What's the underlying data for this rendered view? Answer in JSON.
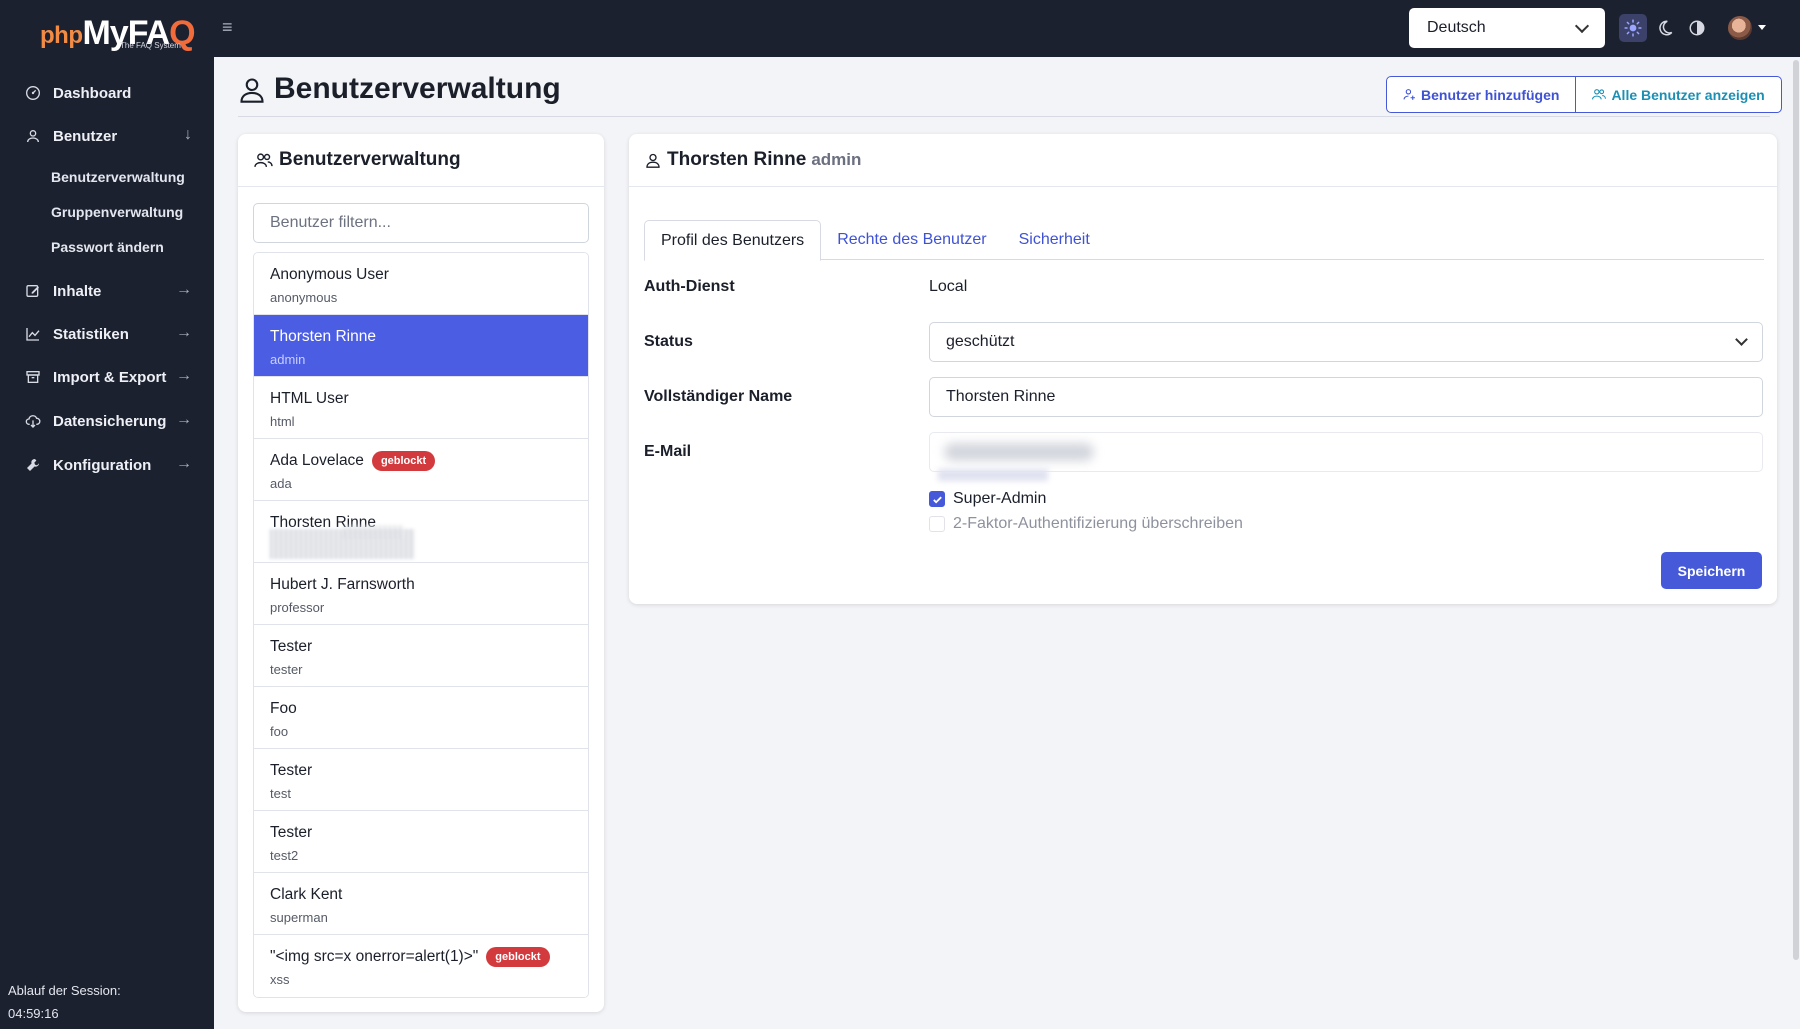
{
  "app": {
    "logo_php": "php",
    "logo_my": "MyFA",
    "logo_q": "Q",
    "logo_sub": "The FAQ System"
  },
  "topbar": {
    "language": "Deutsch"
  },
  "sidebar": {
    "items": [
      {
        "label": "Dashboard",
        "icon": "dashboard-icon"
      },
      {
        "label": "Benutzer",
        "icon": "user-icon",
        "arrow": "↓"
      },
      {
        "label": "Inhalte",
        "icon": "edit-icon",
        "arrow": "→"
      },
      {
        "label": "Statistiken",
        "icon": "chart-icon",
        "arrow": "→"
      },
      {
        "label": "Import & Export",
        "icon": "archive-icon",
        "arrow": "→"
      },
      {
        "label": "Datensicherung",
        "icon": "cloud-download-icon",
        "arrow": "→"
      },
      {
        "label": "Konfiguration",
        "icon": "wrench-icon",
        "arrow": "→"
      }
    ],
    "sub_items": [
      "Benutzerverwaltung",
      "Gruppenverwaltung",
      "Passwort ändern"
    ],
    "session_label": "Ablauf der Session:",
    "session_time": "04:59:16"
  },
  "page": {
    "title": "Benutzerverwaltung",
    "add_user": "Benutzer hinzufügen",
    "show_all": "Alle Benutzer anzeigen"
  },
  "list_card": {
    "title": "Benutzerverwaltung",
    "filter_placeholder": "Benutzer filtern...",
    "users": [
      {
        "name": "Anonymous User",
        "login": "anonymous",
        "badge": ""
      },
      {
        "name": "Thorsten Rinne",
        "login": "admin",
        "badge": ""
      },
      {
        "name": "HTML User",
        "login": "html",
        "badge": ""
      },
      {
        "name": "Ada Lovelace",
        "login": "ada",
        "badge": "geblockt"
      },
      {
        "name": "Thorsten Rinne",
        "login": "",
        "badge": ""
      },
      {
        "name": "Hubert J. Farnsworth",
        "login": "professor",
        "badge": ""
      },
      {
        "name": "Tester",
        "login": "tester",
        "badge": ""
      },
      {
        "name": "Foo",
        "login": "foo",
        "badge": ""
      },
      {
        "name": "Tester",
        "login": "test",
        "badge": ""
      },
      {
        "name": "Tester",
        "login": "test2",
        "badge": ""
      },
      {
        "name": "Clark Kent",
        "login": "superman",
        "badge": ""
      },
      {
        "name": "\"<img src=x onerror=alert(1)>\"",
        "login": "xss",
        "badge": "geblockt"
      }
    ]
  },
  "detail_card": {
    "name": "Thorsten Rinne",
    "login": "admin",
    "tabs": [
      "Profil des Benutzers",
      "Rechte des Benutzer",
      "Sicherheit"
    ],
    "auth_label": "Auth-Dienst",
    "auth_value": "Local",
    "status_label": "Status",
    "status_value": "geschützt",
    "fullname_label": "Vollständiger Name",
    "fullname_value": "Thorsten Rinne",
    "email_label": "E-Mail",
    "superadmin_label": "Super-Admin",
    "twofa_label": "2-Faktor-Authentifizierung überschreiben",
    "save": "Speichern"
  },
  "colors": {
    "sidebar_bg": "#1c2130",
    "primary": "#4659d8",
    "active_row": "#4b5de2",
    "badge": "#d33a3e"
  }
}
